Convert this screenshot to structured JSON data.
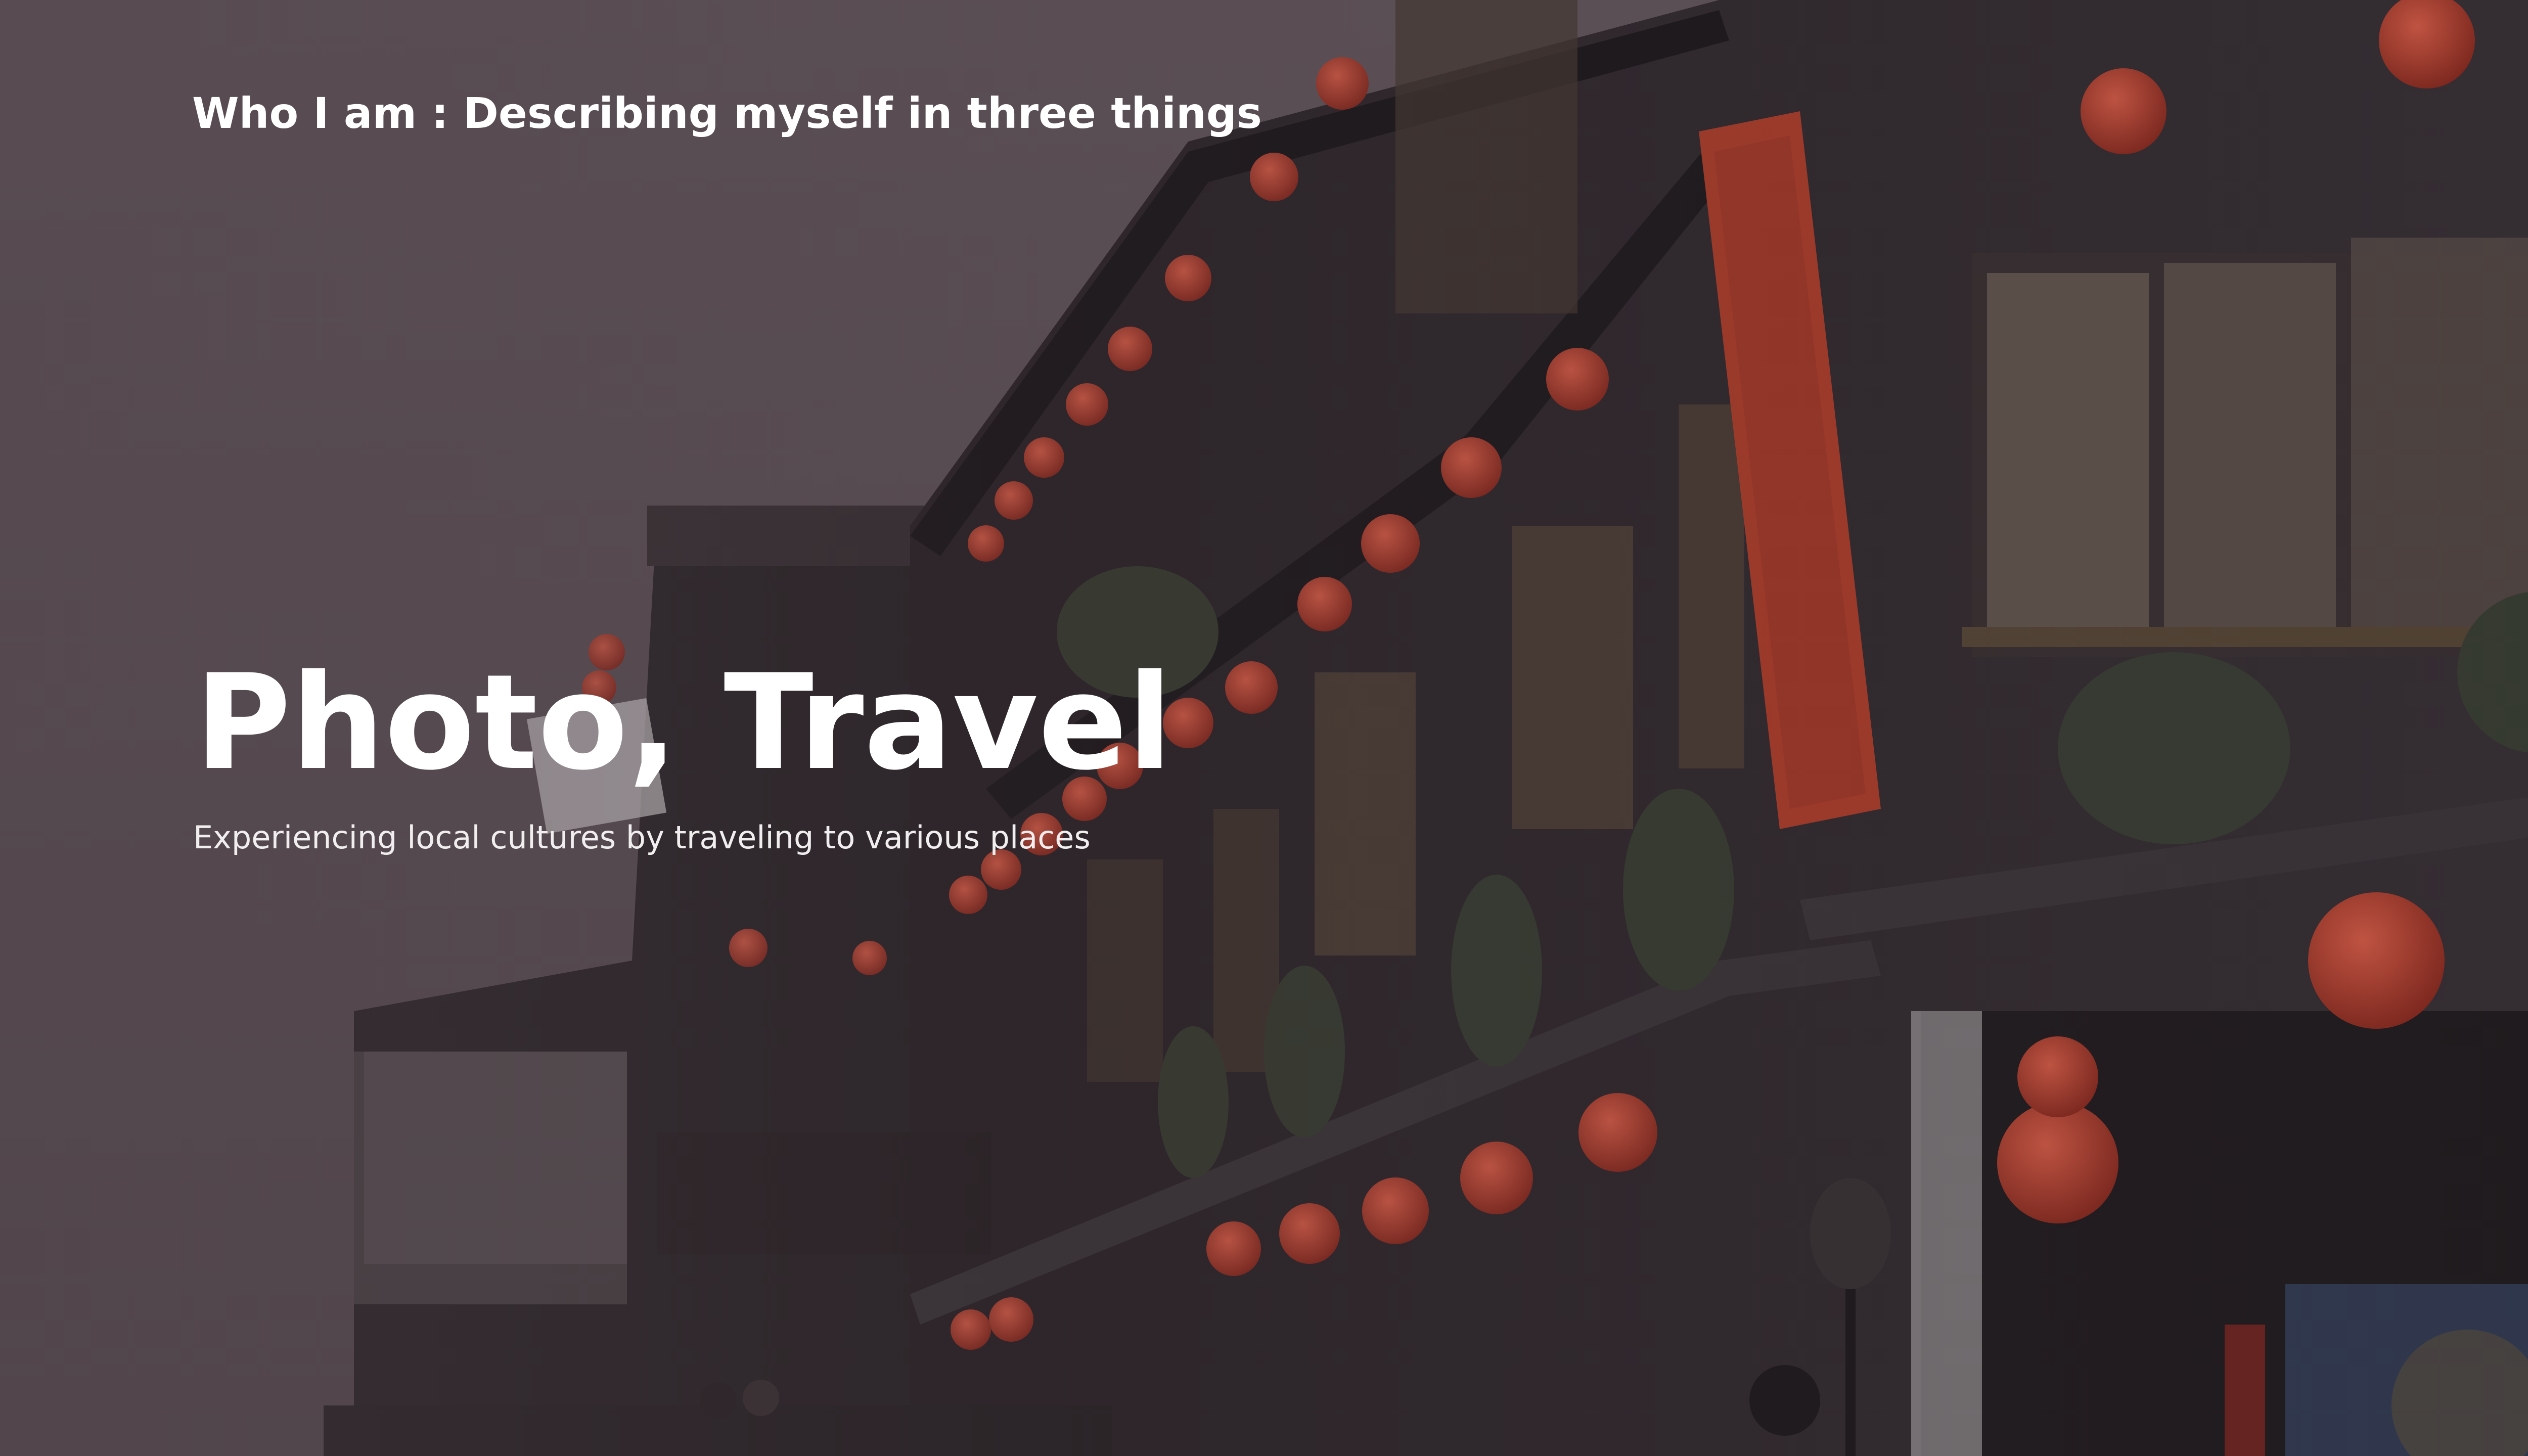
{
  "slide": {
    "kicker": "Who I am : Describing myself in three things",
    "headline": "Photo, Travel",
    "subtitle": "Experiencing local cultures by traveling to various places"
  },
  "background": {
    "description_icon": "teahouse-photo",
    "colors": {
      "sky": "#6b5f65",
      "wood": "#2a2528",
      "lantern": "#c2432f",
      "banner": "#b8402c"
    }
  }
}
